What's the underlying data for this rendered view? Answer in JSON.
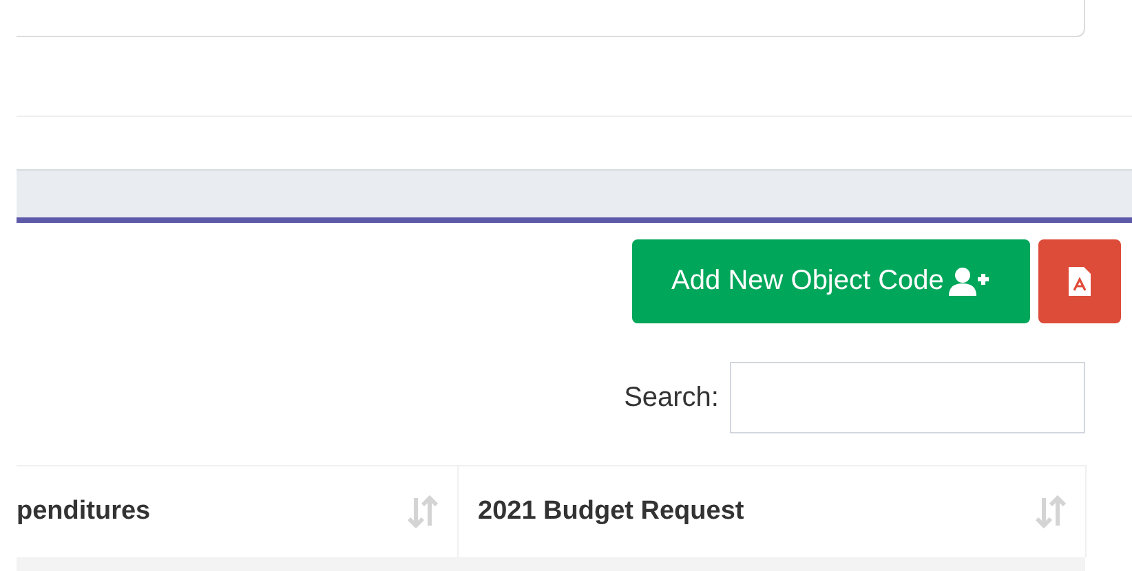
{
  "toolbar": {
    "buttons": [
      {
        "kind": "add",
        "label": "Add New Object Code"
      },
      {
        "kind": "pdf"
      }
    ]
  },
  "search": {
    "label": "Search:"
  },
  "table": {
    "columns": [
      {
        "label": "penditures"
      },
      {
        "label": "2021 Budget Request"
      }
    ]
  }
}
